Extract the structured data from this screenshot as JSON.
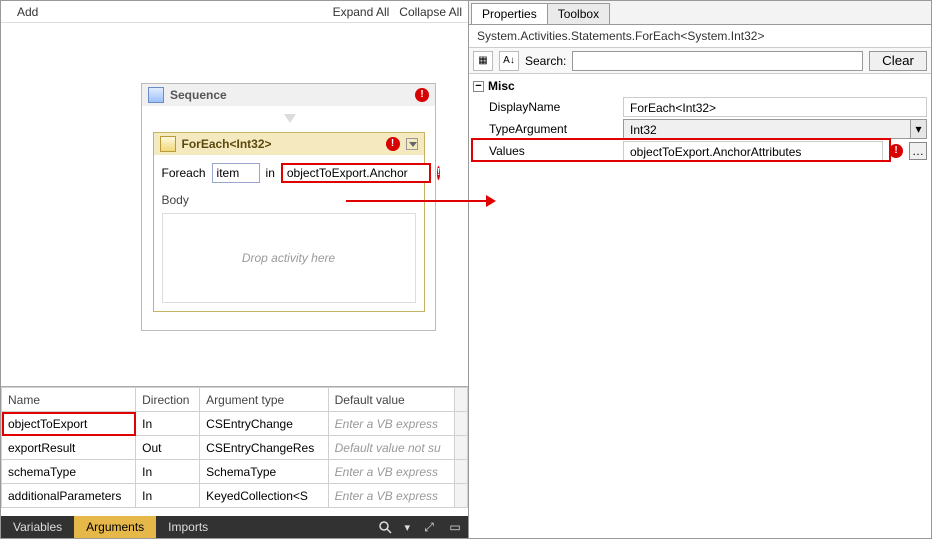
{
  "designer": {
    "toolbar": {
      "add": "Add",
      "expand_all": "Expand All",
      "collapse_all": "Collapse All"
    },
    "sequence": {
      "title": "Sequence",
      "foreach": {
        "title": "ForEach<Int32>",
        "foreach_label": "Foreach",
        "iterator": "item",
        "in_label": "in",
        "source_expr": "objectToExport.Anchor",
        "body_label": "Body",
        "drop_hint": "Drop activity here"
      }
    }
  },
  "arguments_grid": {
    "headers": {
      "name": "Name",
      "direction": "Direction",
      "type": "Argument type",
      "default": "Default value"
    },
    "rows": [
      {
        "name": "objectToExport",
        "direction": "In",
        "type": "CSEntryChange",
        "default": "Enter a VB express",
        "ph": true,
        "highlight": true
      },
      {
        "name": "exportResult",
        "direction": "Out",
        "type": "CSEntryChangeRes",
        "default": "Default value not su",
        "ph": true,
        "highlight": false
      },
      {
        "name": "schemaType",
        "direction": "In",
        "type": "SchemaType",
        "default": "Enter a VB express",
        "ph": true,
        "highlight": false
      },
      {
        "name": "additionalParameters",
        "direction": "In",
        "type": "KeyedCollection<S",
        "default": "Enter a VB express",
        "ph": true,
        "highlight": false
      }
    ]
  },
  "bottom_tabs": {
    "variables": "Variables",
    "arguments": "Arguments",
    "imports": "Imports"
  },
  "properties_panel": {
    "tabs": {
      "properties": "Properties",
      "toolbox": "Toolbox"
    },
    "type_line": "System.Activities.Statements.ForEach<System.Int32>",
    "search_label": "Search:",
    "clear_label": "Clear",
    "category": "Misc",
    "rows": {
      "DisplayName": "ForEach<Int32>",
      "TypeArgument": "Int32",
      "Values": "objectToExport.AnchorAttributes"
    }
  }
}
